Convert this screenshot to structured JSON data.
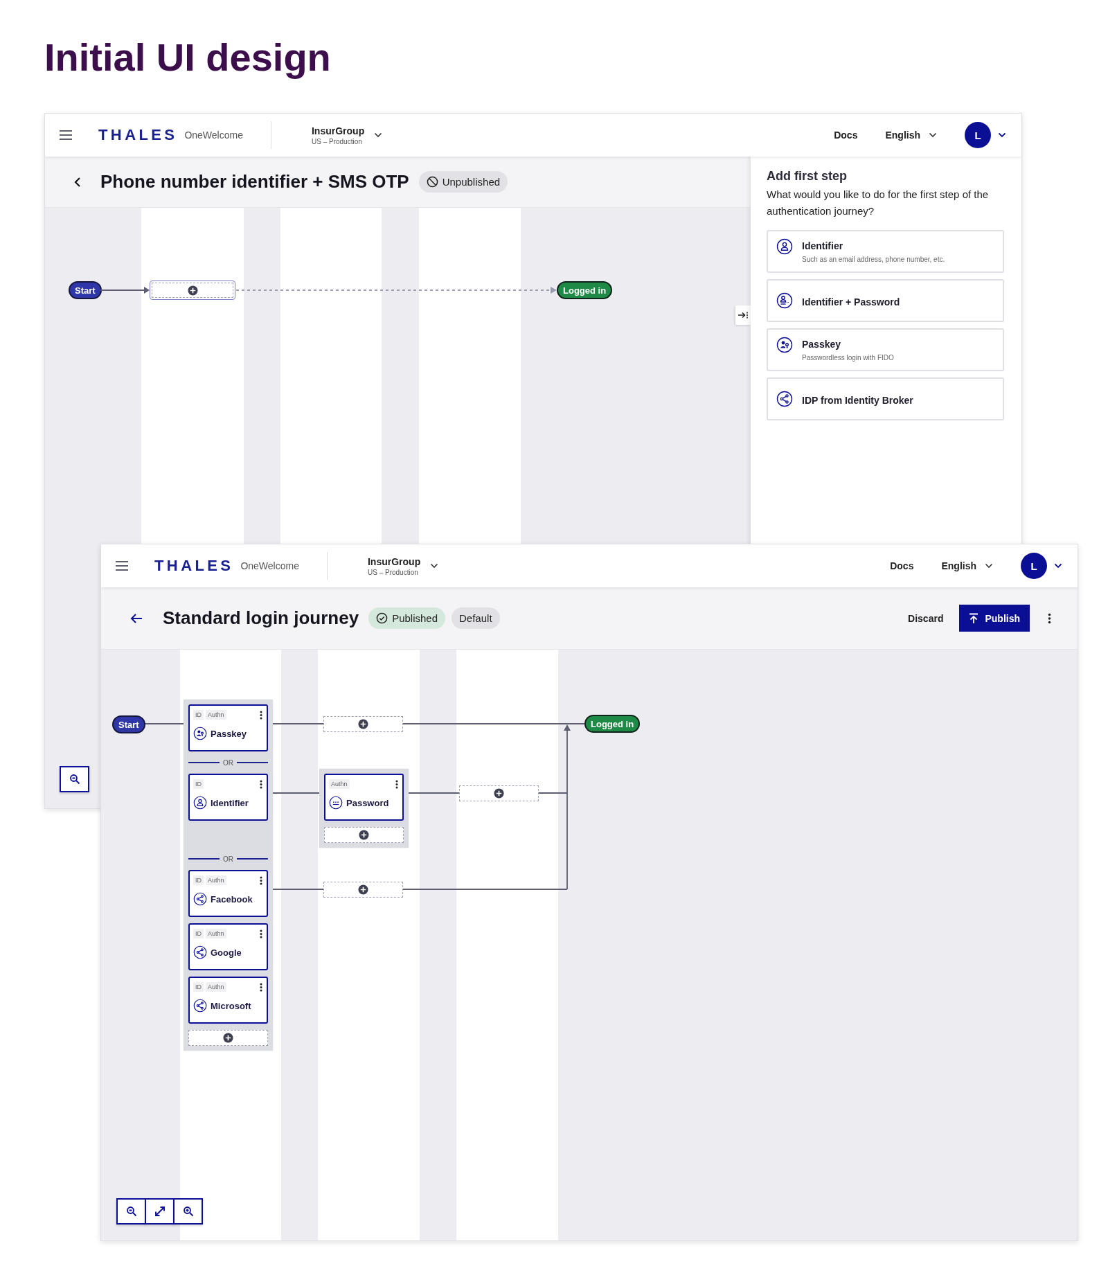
{
  "page_title": "Initial UI design",
  "draft_window": {
    "header": {
      "logo": "THALES",
      "product": "OneWelcome",
      "tenant": "InsurGroup",
      "environment": "US – Production",
      "docs": "Docs",
      "language": "English",
      "avatar": "L"
    },
    "journey": {
      "title": "Phone number identifier + SMS OTP",
      "status": {
        "label": "Unpublished",
        "published": false
      }
    },
    "flow": {
      "start": "Start",
      "end": "Logged in"
    },
    "panel": {
      "title": "Add first step",
      "prompt": "What would you like to do for the first step of the authentication journey?",
      "options": [
        {
          "title": "Identifier",
          "description": "Such as an email address, phone number, etc.",
          "kind": "identifier"
        },
        {
          "title": "Identifier + Password",
          "kind": "identifier-password"
        },
        {
          "title": "Passkey",
          "description": "Passwordless login with FIDO",
          "kind": "passkey"
        },
        {
          "title": "IDP from Identity Broker",
          "kind": "broker"
        }
      ]
    }
  },
  "published_window": {
    "header": {
      "logo": "THALES",
      "product": "OneWelcome",
      "tenant": "InsurGroup",
      "environment": "US – Production",
      "docs": "Docs",
      "language": "English",
      "avatar": "L"
    },
    "journey": {
      "title": "Standard login journey",
      "status": {
        "label": "Published",
        "published": true
      },
      "badges": [
        "Default"
      ],
      "actions": [
        {
          "label": "Discard",
          "kind": "text"
        },
        {
          "label": "Publish",
          "kind": "primary"
        }
      ]
    },
    "flow": {
      "start": "Start",
      "end": "Logged in",
      "branches": [
        {
          "cards": [
            {
              "tags": [
                "ID",
                "Authn"
              ],
              "label": "Passkey",
              "kind": "passkey"
            }
          ]
        },
        {
          "separator": "OR",
          "cards": [
            {
              "tags": [
                "ID"
              ],
              "label": "Identifier",
              "kind": "identifier"
            }
          ],
          "steps": [
            {
              "tags": [
                "Authn"
              ],
              "label": "Password",
              "kind": "password"
            }
          ]
        },
        {
          "separator": "OR",
          "cards": [
            {
              "tags": [
                "ID",
                "Authn"
              ],
              "label": "Facebook",
              "kind": "broker"
            },
            {
              "tags": [
                "ID",
                "Authn"
              ],
              "label": "Google",
              "kind": "broker"
            },
            {
              "tags": [
                "ID",
                "Authn"
              ],
              "label": "Microsoft",
              "kind": "broker"
            }
          ]
        }
      ]
    }
  }
}
